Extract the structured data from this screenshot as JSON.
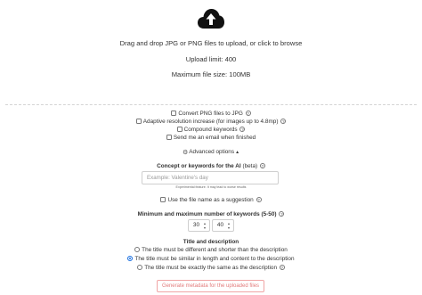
{
  "upload": {
    "icon": "cloud-upload-icon",
    "instruction": "Drag and drop JPG or PNG files to upload, or click to browse",
    "limit": "Upload limit: 400",
    "max_size": "Maximum file size: 100MB"
  },
  "options": {
    "convert_png": {
      "label": "Convert PNG files to JPG",
      "checked": false
    },
    "adaptive_resolution": {
      "label": "Adaptive resolution increase (for images up to 4.8mp)",
      "checked": false
    },
    "compound_keywords": {
      "label": "Compound keywords",
      "checked": false
    },
    "send_email": {
      "label": "Send me an email when finished",
      "checked": false
    }
  },
  "advanced": {
    "label": "Advanced options",
    "concept": {
      "label": "Concept or keywords for the AI",
      "beta": "(beta)",
      "placeholder": "Example: Valentine's day",
      "note": "Experimental feature. It may lead to worse results"
    },
    "use_filename": {
      "label": "Use the file name as a suggestion",
      "checked": false
    },
    "keyword_range": {
      "label": "Minimum and maximum number of keywords (5-50)",
      "min": "30",
      "max": "40"
    },
    "title_description": {
      "label": "Title and description",
      "options": [
        {
          "label": "The title must be different and shorter than the description",
          "checked": false
        },
        {
          "label": "The title must be similar in length and content to the description",
          "checked": true
        },
        {
          "label": "The title must be exactly the same as the description",
          "checked": false
        }
      ]
    }
  },
  "generate_button": {
    "label": "Generate metadata for the uploaded files"
  }
}
